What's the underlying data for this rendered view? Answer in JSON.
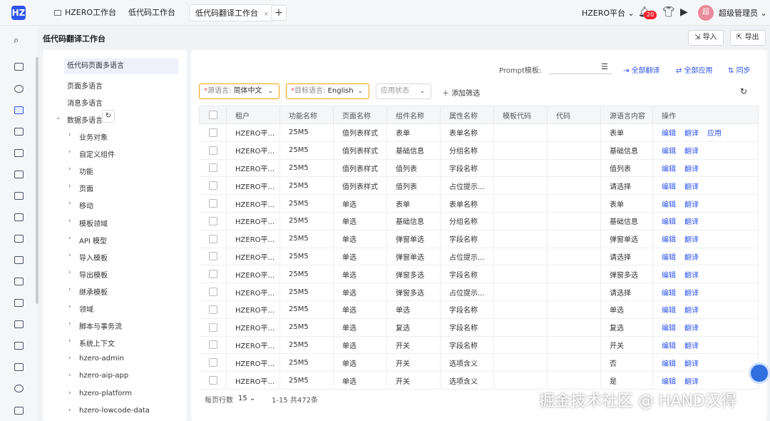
{
  "topbar": {
    "logo": "HZ",
    "tabs": [
      {
        "label": "HZERO工作台"
      },
      {
        "label": "低代码工作台"
      },
      {
        "label": "低代码翻译工作台",
        "close": "×"
      }
    ],
    "add_tab": "+",
    "platform": "HZERO平台 ⌄",
    "notification_count": "20",
    "avatar_text": "超",
    "user_name": "超级管理员 ⌄"
  },
  "page": {
    "title": "低代码翻译工作台",
    "import_label": "导入",
    "export_label": "导出"
  },
  "tree": {
    "top_items": [
      "低代码页面多语言",
      "页面多语言",
      "消息多语言"
    ],
    "group_label": "数据多语言",
    "children": [
      "业务对象",
      "自定义组件",
      "功能",
      "页面",
      "移动",
      "模板领域",
      "API 模型",
      "导入模板",
      "导出模板",
      "继承模板",
      "领域",
      "脚本与事务流",
      "系统上下文",
      "hzero-admin",
      "hzero-aip-app",
      "hzero-platform",
      "hzero-lowcode-data"
    ]
  },
  "toolbar": {
    "prompt_label": "Prompt模板:",
    "translate_all": "全部翻译",
    "apply_all": "全部应用",
    "sync": "同步"
  },
  "filters": {
    "source_lang_label": "源语言:",
    "source_lang_value": "简体中文",
    "target_lang_label": "目标语言:",
    "target_lang_value": "English",
    "status_placeholder": "应用状态",
    "add_filter": "添加筛选"
  },
  "table": {
    "headers": [
      "租户",
      "功能名称",
      "页面名称",
      "组件名称",
      "属性名称",
      "模板代码",
      "代码",
      "源语言内容",
      "操作"
    ],
    "rows": [
      [
        "HZERO平...",
        "25M5",
        "值列表样式",
        "表单",
        "表单名称",
        "",
        "",
        "表单"
      ],
      [
        "HZERO平...",
        "25M5",
        "值列表样式",
        "基础信息",
        "分组名称",
        "",
        "",
        "基础信息"
      ],
      [
        "HZERO平...",
        "25M5",
        "值列表样式",
        "值列表",
        "字段名称",
        "",
        "",
        "值列表"
      ],
      [
        "HZERO平...",
        "25M5",
        "值列表样式",
        "值列表",
        "占位提示...",
        "",
        "",
        "请选择"
      ],
      [
        "HZERO平...",
        "25M5",
        "单选",
        "表单",
        "表单名称",
        "",
        "",
        "表单"
      ],
      [
        "HZERO平...",
        "25M5",
        "单选",
        "基础信息",
        "分组名称",
        "",
        "",
        "基础信息"
      ],
      [
        "HZERO平...",
        "25M5",
        "单选",
        "弹窗单选",
        "字段名称",
        "",
        "",
        "弹窗单选"
      ],
      [
        "HZERO平...",
        "25M5",
        "单选",
        "弹窗单选",
        "占位提示...",
        "",
        "",
        "请选择"
      ],
      [
        "HZERO平...",
        "25M5",
        "单选",
        "弹窗多选",
        "字段名称",
        "",
        "",
        "弹窗多选"
      ],
      [
        "HZERO平...",
        "25M5",
        "单选",
        "弹窗多选",
        "占位提示...",
        "",
        "",
        "请选择"
      ],
      [
        "HZERO平...",
        "25M5",
        "单选",
        "单选",
        "字段名称",
        "",
        "",
        "单选"
      ],
      [
        "HZERO平...",
        "25M5",
        "单选",
        "复选",
        "字段名称",
        "",
        "",
        "复选"
      ],
      [
        "HZERO平...",
        "25M5",
        "单选",
        "开关",
        "字段名称",
        "",
        "",
        "开关"
      ],
      [
        "HZERO平...",
        "25M5",
        "单选",
        "开关",
        "选项含义",
        "",
        "",
        "否"
      ],
      [
        "HZERO平...",
        "25M5",
        "单选",
        "开关",
        "选项含义",
        "",
        "",
        "是"
      ]
    ],
    "op_edit": "编辑",
    "op_translate": "翻译",
    "op_apply": "应用"
  },
  "pagination": {
    "rows_per_page_label": "每页行数",
    "rows_per_page": "15 ⌄",
    "range": "1-15 共472条"
  },
  "watermark": "掘金技术社区 @ HAND汉得",
  "colors": {
    "accent": "#2f54eb",
    "required": "#f04864",
    "badge": "#f5222d"
  }
}
